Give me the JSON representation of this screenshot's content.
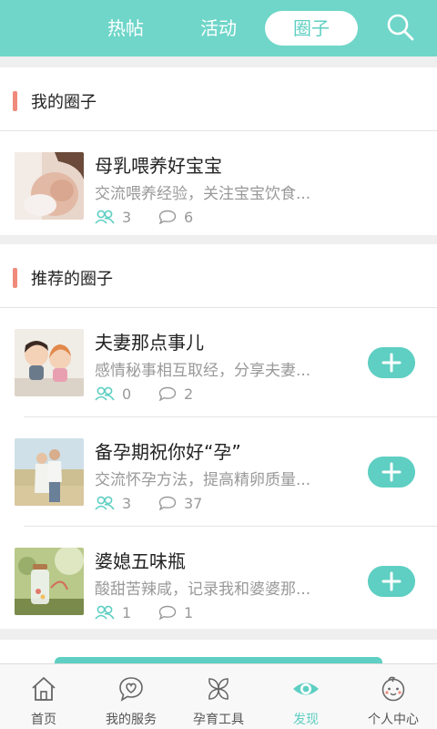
{
  "topbar": {
    "tabs": [
      {
        "label": "热帖",
        "active": false
      },
      {
        "label": "活动",
        "active": false
      },
      {
        "label": "圈子",
        "active": true
      }
    ],
    "icon": "search-icon"
  },
  "my_circles": {
    "title": "我的圈子",
    "items": [
      {
        "name": "母乳喂养好宝宝",
        "desc": "交流喂养经验，关注宝宝饮食...",
        "members": "3",
        "comments": "6"
      }
    ]
  },
  "recommended": {
    "title": "推荐的圈子",
    "items": [
      {
        "name": "夫妻那点事儿",
        "desc": "感情秘事相互取经，分享夫妻...",
        "members": "0",
        "comments": "2"
      },
      {
        "name": "备孕期祝你好“孕”",
        "desc": "交流怀孕方法，提高精卵质量...",
        "members": "3",
        "comments": "37"
      },
      {
        "name": "婆媳五味瓶",
        "desc": "酸甜苦辣咸，记录我和婆婆那...",
        "members": "1",
        "comments": "1"
      }
    ]
  },
  "bottom_nav": {
    "items": [
      {
        "label": "首页",
        "icon": "home-icon"
      },
      {
        "label": "我的服务",
        "icon": "heart-chat-icon"
      },
      {
        "label": "孕育工具",
        "icon": "flower-icon"
      },
      {
        "label": "发现",
        "icon": "eye-icon",
        "active": true
      },
      {
        "label": "个人中心",
        "icon": "baby-face-icon"
      }
    ]
  },
  "colors": {
    "accent": "#6fd6c9",
    "button": "#5ecfc2",
    "section_bar": "#ef8a7c"
  }
}
